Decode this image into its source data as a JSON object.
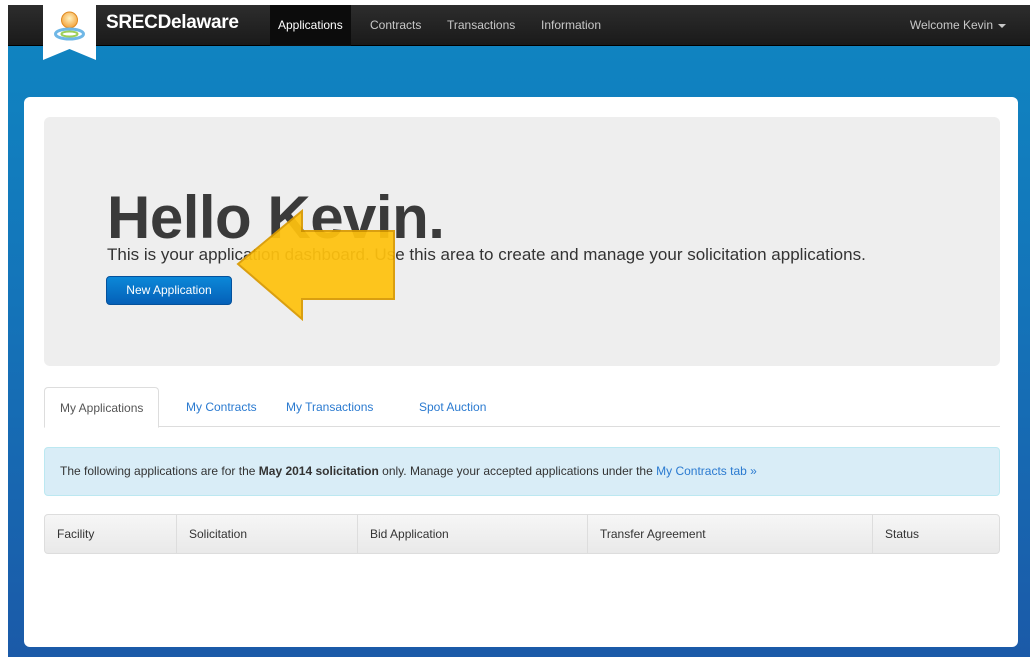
{
  "navbar": {
    "brand": "SRECDelaware",
    "items": [
      {
        "label": "Applications",
        "active": true
      },
      {
        "label": "Contracts",
        "active": false
      },
      {
        "label": "Transactions",
        "active": false
      },
      {
        "label": "Information",
        "active": false
      }
    ],
    "welcome": "Welcome Kevin"
  },
  "hero": {
    "title": "Hello Kevin.",
    "subtitle": "This is your application dashboard. Use this area to create and manage your solicitation applications.",
    "new_button": "New Application"
  },
  "tabs": [
    {
      "label": "My Applications",
      "active": true
    },
    {
      "label": "My Contracts",
      "active": false
    },
    {
      "label": "My Transactions",
      "active": false
    },
    {
      "label": "Spot Auction",
      "active": false
    }
  ],
  "alert": {
    "prefix": "The following applications are for the ",
    "bold": "May 2014 solicitation",
    "middle": " only. Manage your accepted applications under the ",
    "link": "My Contracts tab »"
  },
  "table": {
    "columns": [
      "Facility",
      "Solicitation",
      "Bid Application",
      "Transfer Agreement",
      "Status"
    ]
  },
  "colors": {
    "navbar": "#1f1f1f",
    "background_gradient_top": "#0f86c2",
    "primary_button": "#0a7bd0",
    "arrow": "#ffc20e",
    "alert_bg": "#d9edf7",
    "link": "#2a7ad0"
  },
  "icons": {
    "logo": "sun-person-logo-icon",
    "welcome_caret": "caret-down-icon",
    "overlay": "yellow-arrow-left-icon"
  }
}
